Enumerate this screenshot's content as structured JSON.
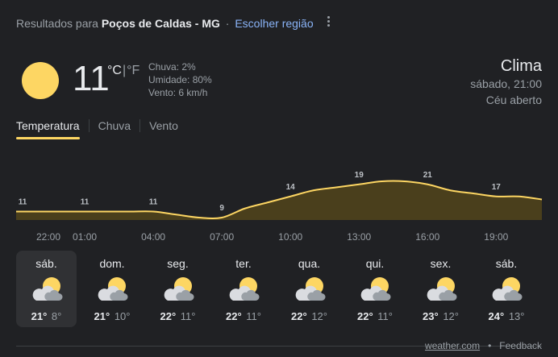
{
  "header": {
    "prefix": "Resultados para",
    "location": "Poços de Caldas - MG",
    "separator": "·",
    "change_region": "Escolher região"
  },
  "current": {
    "icon": "sun-icon",
    "temperature": "11",
    "unit_c": "°C",
    "unit_sep": "|",
    "unit_f": "°F",
    "precipitation": "Chuva: 2%",
    "humidity": "Umidade: 80%",
    "wind": "Vento: 6 km/h"
  },
  "summary": {
    "title": "Clima",
    "datetime": "sábado, 21:00",
    "condition": "Céu aberto"
  },
  "tabs": [
    {
      "label": "Temperatura",
      "active": true
    },
    {
      "label": "Chuva",
      "active": false
    },
    {
      "label": "Vento",
      "active": false
    }
  ],
  "chart_data": {
    "type": "area",
    "x": [
      "22:00",
      "23:00",
      "00:00",
      "01:00",
      "02:00",
      "03:00",
      "04:00",
      "05:00",
      "06:00",
      "07:00",
      "08:00",
      "09:00",
      "10:00",
      "11:00",
      "12:00",
      "13:00",
      "14:00",
      "15:00",
      "16:00",
      "17:00",
      "18:00",
      "19:00",
      "20:00",
      "21:00"
    ],
    "values": [
      11,
      11,
      11,
      11,
      11,
      11,
      11,
      10,
      9,
      9,
      12,
      14,
      16,
      18,
      19,
      20,
      21,
      21,
      20,
      18,
      17,
      16,
      16,
      15
    ],
    "labels": [
      {
        "x": "22:00",
        "value": "11"
      },
      {
        "x": "01:00",
        "value": "11"
      },
      {
        "x": "04:00",
        "value": "11"
      },
      {
        "x": "07:00",
        "value": "9"
      },
      {
        "x": "10:00",
        "value": "14"
      },
      {
        "x": "13:00",
        "value": "19"
      },
      {
        "x": "16:00",
        "value": "21"
      },
      {
        "x": "19:00",
        "value": "17"
      }
    ],
    "tick_labels": [
      "22:00",
      "01:00",
      "04:00",
      "07:00",
      "10:00",
      "13:00",
      "16:00",
      "19:00"
    ],
    "line_color": "#fdd663",
    "fill_color": "#4a3f1c"
  },
  "forecast": [
    {
      "day": "sáb.",
      "high": "21°",
      "low": "8°",
      "icon": "partly-cloudy-icon",
      "selected": true
    },
    {
      "day": "dom.",
      "high": "21°",
      "low": "10°",
      "icon": "partly-cloudy-icon",
      "selected": false
    },
    {
      "day": "seg.",
      "high": "22°",
      "low": "11°",
      "icon": "partly-cloudy-icon",
      "selected": false
    },
    {
      "day": "ter.",
      "high": "22°",
      "low": "11°",
      "icon": "partly-cloudy-icon",
      "selected": false
    },
    {
      "day": "qua.",
      "high": "22°",
      "low": "12°",
      "icon": "partly-cloudy-icon",
      "selected": false
    },
    {
      "day": "qui.",
      "high": "22°",
      "low": "11°",
      "icon": "partly-cloudy-icon",
      "selected": false
    },
    {
      "day": "sex.",
      "high": "23°",
      "low": "12°",
      "icon": "partly-cloudy-icon",
      "selected": false
    },
    {
      "day": "sáb.",
      "high": "24°",
      "low": "13°",
      "icon": "partly-cloudy-icon",
      "selected": false
    }
  ],
  "footer": {
    "source": "weather.com",
    "separator": "•",
    "feedback": "Feedback"
  },
  "colors": {
    "background": "#202124",
    "accent": "#fdd663",
    "link": "#8ab4f8"
  }
}
